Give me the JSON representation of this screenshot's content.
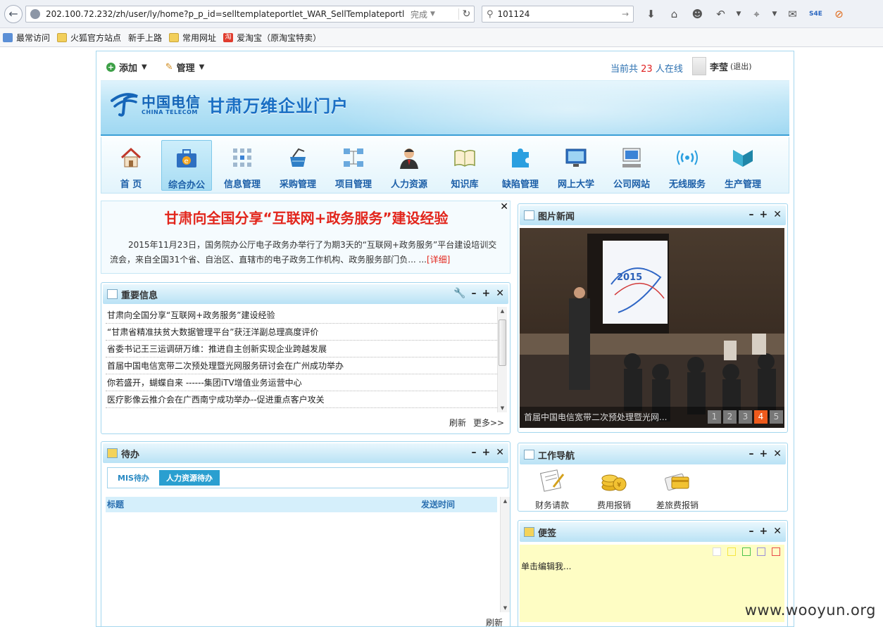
{
  "browser": {
    "url": "202.100.72.232/zh/user/ly/home?p_p_id=selltemplateportlet_WAR_SellTemplateportlet...",
    "status": "完成",
    "search_value": "101124"
  },
  "bookmarks": [
    {
      "label": "最常访问"
    },
    {
      "label": "火狐官方站点"
    },
    {
      "label": "新手上路"
    },
    {
      "label": "常用网址"
    },
    {
      "label": "爱淘宝（原淘宝特卖）"
    }
  ],
  "topbar": {
    "add_label": "添加",
    "manage_label": "管理",
    "online_prefix": "当前共",
    "online_count": "23",
    "online_suffix": "人在线",
    "user_name": "李莹",
    "logout_label": "(退出)"
  },
  "banner": {
    "logo_cn": "中国电信",
    "logo_en": "CHINA TELECOM",
    "site_title": "甘肃万维企业门户"
  },
  "nav": [
    {
      "label": "首 页",
      "icon": "home-icon"
    },
    {
      "label": "综合办公",
      "icon": "office-briefcase-icon",
      "active": true
    },
    {
      "label": "信息管理",
      "icon": "info-grid-icon"
    },
    {
      "label": "采购管理",
      "icon": "purchase-basket-icon"
    },
    {
      "label": "项目管理",
      "icon": "project-tree-icon"
    },
    {
      "label": "人力资源",
      "icon": "person-icon"
    },
    {
      "label": "知识库",
      "icon": "book-icon"
    },
    {
      "label": "缺陷管理",
      "icon": "puzzle-icon"
    },
    {
      "label": "网上大学",
      "icon": "screen-icon"
    },
    {
      "label": "公司网站",
      "icon": "computer-icon"
    },
    {
      "label": "无线服务",
      "icon": "wireless-icon"
    },
    {
      "label": "生产管理",
      "icon": "production-icon"
    }
  ],
  "headline": {
    "title": "甘肃向全国分享“互联网+政务服务”建设经验",
    "body": "2015年11月23日，国务院办公厅电子政务办举行了为期3天的“互联网+政务服务”平台建设培训交流会，来自全国31个省、自治区、直辖市的电子政务工作机构、政务服务部门负... ...",
    "more_label": "[详细]"
  },
  "important": {
    "title": "重要信息",
    "items": [
      "甘肃向全国分享“互联网+政务服务”建设经验",
      "“甘肃省精准扶贫大数据管理平台”获汪洋副总理高度评价",
      "省委书记王三运调研万维：推进自主创新实现企业跨越发展",
      "首届中国电信宽带二次预处理暨光网服务研讨会在广州成功举办",
      "你若盛开，蝴蝶自来 ------集团iTV增值业务运营中心",
      "医疗影像云推介会在广西南宁成功举办--促进重点客户攻关"
    ],
    "refresh_label": "刷新",
    "more_label": "更多>>"
  },
  "photo_news": {
    "title": "图片新闻",
    "caption": "首届中国电信宽带二次预处理暨光网...",
    "slide_text": "2015",
    "pages": [
      "1",
      "2",
      "3",
      "4",
      "5"
    ],
    "current_page": 4
  },
  "todo": {
    "title": "待办",
    "tabs": [
      "MIS待办",
      "人力资源待办"
    ],
    "active_tab": 1,
    "col_title": "标题",
    "col_time": "发送时间",
    "refresh_label": "刷新"
  },
  "work_nav": {
    "title": "工作导航",
    "items": [
      {
        "label": "财务请款",
        "icon": "finance-request-icon"
      },
      {
        "label": "费用报销",
        "icon": "coins-icon"
      },
      {
        "label": "差旅费报销",
        "icon": "travel-card-icon"
      }
    ]
  },
  "note": {
    "title": "便签",
    "placeholder": "单击编辑我...",
    "swatch_colors": [
      "#ffffff",
      "#f5e642",
      "#4cc34c",
      "#9a8fd8",
      "#e84a4a"
    ]
  },
  "watermark": "www.wooyun.org"
}
